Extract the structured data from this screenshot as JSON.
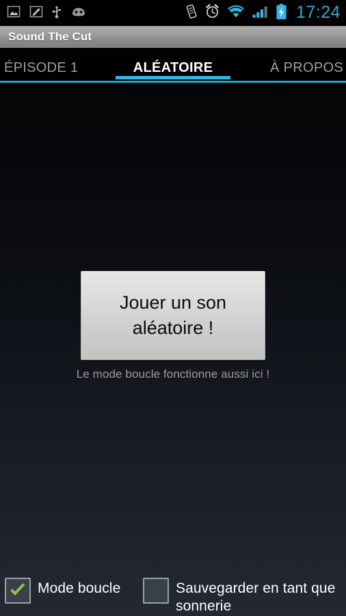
{
  "status_bar": {
    "icons_left": [
      "image-icon",
      "compose-icon",
      "usb-icon",
      "cyanogenmod-icon"
    ],
    "icons_right": [
      "vibrate-icon",
      "alarm-icon",
      "wifi-icon",
      "signal-icon",
      "battery-charging-icon"
    ],
    "time": "17:24",
    "time_color": "#2eaad4"
  },
  "action_bar": {
    "title": "Sound The Cut"
  },
  "tabs": [
    {
      "label": "ÉPISODE 1",
      "active": false
    },
    {
      "label": "ALÉATOIRE",
      "active": true
    },
    {
      "label": "À PROPOS",
      "active": false
    }
  ],
  "main": {
    "play_button_line1": "Jouer un son",
    "play_button_line2": "aléatoire !",
    "hint": "Le mode boucle fonctionne aussi ici !"
  },
  "checkboxes": [
    {
      "label": "Mode boucle",
      "checked": true
    },
    {
      "label": "Sauvegarder en tant que sonnerie",
      "checked": false
    }
  ],
  "colors": {
    "accent_blue": "#33b5e5",
    "check_green": "#8cc63e",
    "tab_inactive": "#a0a0a0",
    "hint_gray": "#9b9b9b"
  }
}
